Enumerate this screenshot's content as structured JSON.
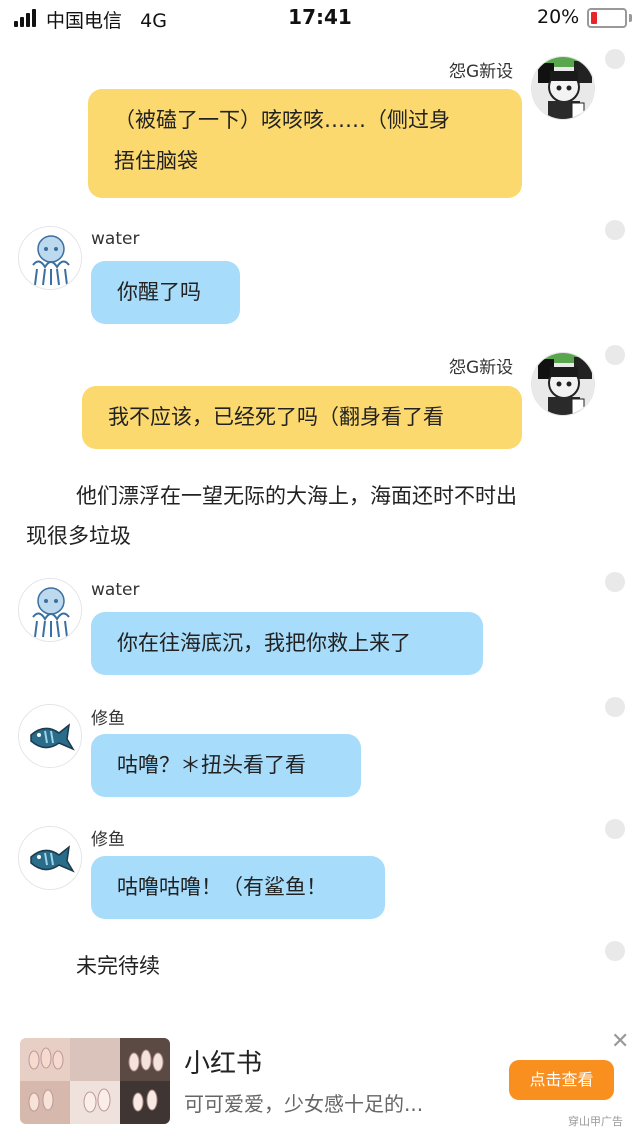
{
  "status_bar": {
    "carrier": "中国电信",
    "network": "4G",
    "time": "17:41",
    "battery_percent": "20%",
    "battery_level": 0.2,
    "battery_color": "#e8252a"
  },
  "colors": {
    "bubble_yellow": "#fbd96e",
    "bubble_blue": "#a8dcfb",
    "ad_button": "#f98f1e"
  },
  "messages": [
    {
      "sender": "怨G新设",
      "side": "right",
      "text_lines": [
        "（被磕了一下）咳咳咳……（侧过身",
        "捂住脑袋"
      ]
    },
    {
      "sender": "water",
      "side": "left",
      "text_lines": [
        "你醒了吗"
      ]
    },
    {
      "sender": "怨G新设",
      "side": "right",
      "text_lines": [
        "我不应该，已经死了吗（翻身看了看"
      ]
    },
    {
      "narration_lines": [
        "他们漂浮在一望无际的大海上，海面还时不时出",
        "现很多垃圾"
      ]
    },
    {
      "sender": "water",
      "side": "left",
      "text_lines": [
        "你在往海底沉，我把你救上来了"
      ]
    },
    {
      "sender": "修鱼",
      "side": "left",
      "text_lines": [
        "咕噜？＊扭头看了看"
      ]
    },
    {
      "sender": "修鱼",
      "side": "left",
      "text_lines": [
        "咕噜咕噜！（有鲨鱼！"
      ]
    },
    {
      "narration_lines": [
        "未完待续"
      ]
    }
  ],
  "ad": {
    "title": "小红书",
    "description": "可可爱爱，少女感十足的...",
    "button_label": "点击查看",
    "close_glyph": "✕",
    "label": "穿山甲广告"
  }
}
